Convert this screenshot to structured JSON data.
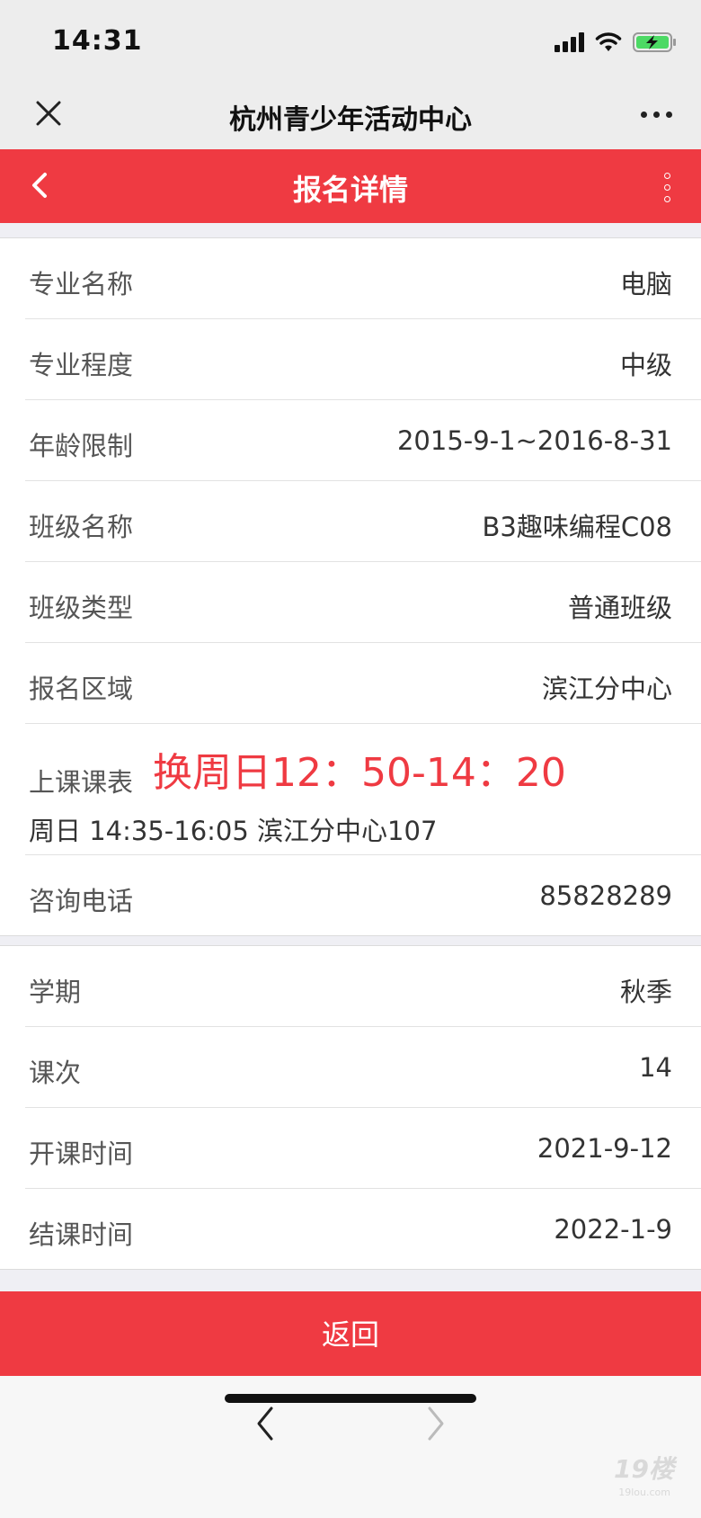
{
  "status_bar": {
    "time": "14:31"
  },
  "nav_bar": {
    "title": "杭州青少年活动中心"
  },
  "header": {
    "title": "报名详情"
  },
  "group1": [
    {
      "label": "专业名称",
      "value": "电脑"
    },
    {
      "label": "专业程度",
      "value": "中级"
    },
    {
      "label": "年龄限制",
      "value": "2015-9-1~2016-8-31"
    },
    {
      "label": "班级名称",
      "value": "B3趣味编程C08"
    },
    {
      "label": "班级类型",
      "value": "普通班级"
    },
    {
      "label": "报名区域",
      "value": "滨江分中心"
    }
  ],
  "schedule": {
    "label": "上课课表",
    "note": "换周日12：50-14：20",
    "detail": "周日 14:35-16:05 滨江分中心107"
  },
  "phone": {
    "label": "咨询电话",
    "value": "85828289"
  },
  "group2": [
    {
      "label": "学期",
      "value": "秋季"
    },
    {
      "label": "课次",
      "value": "14"
    },
    {
      "label": "开课时间",
      "value": "2021-9-12"
    },
    {
      "label": "结课时间",
      "value": "2022-1-9"
    }
  ],
  "return_button": {
    "label": "返回"
  },
  "watermark": {
    "main": "19楼",
    "sub": "19lou.com"
  },
  "colors": {
    "accent": "#ef3a42",
    "battery": "#4cd964"
  }
}
